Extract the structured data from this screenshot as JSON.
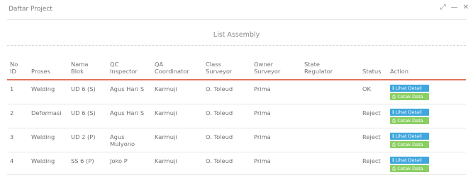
{
  "panel": {
    "title": "Daftar Project"
  },
  "window_controls": {
    "expand": "⤢",
    "minimize": "—",
    "close": "✕"
  },
  "list_title": "List Assembly",
  "columns": [
    [
      "No",
      "ID"
    ],
    [
      "Proses",
      ""
    ],
    [
      "Nama",
      "Blok"
    ],
    [
      "QC",
      "Inspector"
    ],
    [
      "QA",
      "Coordinator"
    ],
    [
      "Class",
      "Surveyor"
    ],
    [
      "Owner",
      "Surveyor"
    ],
    [
      "State",
      "Regulator"
    ],
    [
      "Status",
      ""
    ],
    [
      "Action",
      ""
    ]
  ],
  "buttons": {
    "detail": "Lihat Detail",
    "cetak": "Cetak Data"
  },
  "rows": [
    {
      "id": "1",
      "proses": "Welding",
      "blok": "UD 6 (S)",
      "qc": "Agus Hari S",
      "qa": "Karmuji",
      "class": "O. Toleud",
      "owner": "Prima",
      "state": "",
      "status": "OK"
    },
    {
      "id": "2",
      "proses": "Deformasi",
      "blok": "UD 6 (S)",
      "qc": "Agus Hari S",
      "qa": "Karmuji",
      "class": "O. Toleud",
      "owner": "Prima",
      "state": "",
      "status": "Reject"
    },
    {
      "id": "3",
      "proses": "Welding",
      "blok": "UD 2 (P)",
      "qc": "Agus Mulyono",
      "qa": "Karmuji",
      "class": "O. Toleud",
      "owner": "Prima",
      "state": "",
      "status": "Reject"
    },
    {
      "id": "4",
      "proses": "Welding",
      "blok": "SS 6 (P)",
      "qc": "Joko P",
      "qa": "Karmuji",
      "class": "O. Toleud",
      "owner": "Prima",
      "state": "",
      "status": "Reject"
    }
  ]
}
